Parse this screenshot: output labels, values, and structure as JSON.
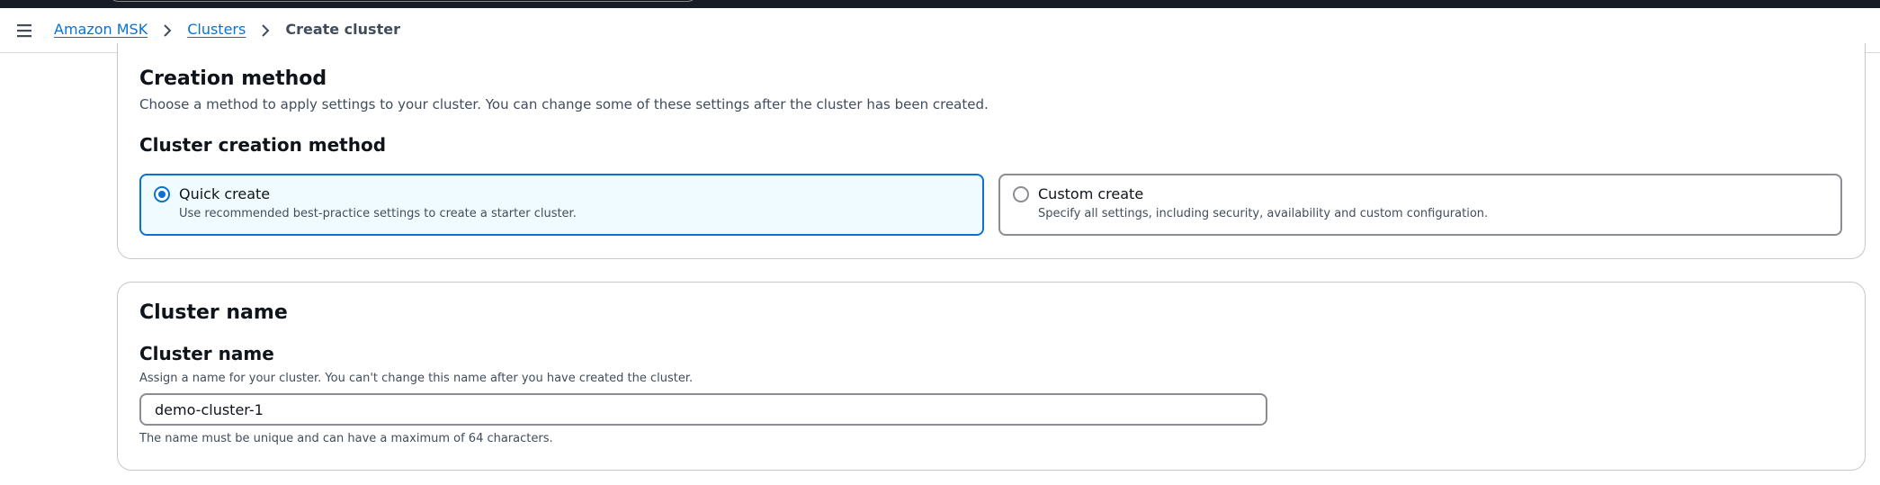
{
  "breadcrumb": {
    "items": [
      "Amazon MSK",
      "Clusters"
    ],
    "current": "Create cluster"
  },
  "creation_method": {
    "title": "Creation method",
    "description": "Choose a method to apply settings to your cluster. You can change some of these settings after the cluster has been created.",
    "field_label": "Cluster creation method",
    "options": [
      {
        "label": "Quick create",
        "description": "Use recommended best-practice settings to create a starter cluster.",
        "selected": true
      },
      {
        "label": "Custom create",
        "description": "Specify all settings, including security, availability and custom configuration.",
        "selected": false
      }
    ]
  },
  "cluster_name": {
    "title": "Cluster name",
    "field_label": "Cluster name",
    "field_description": "Assign a name for your cluster. You can't change this name after you have created the cluster.",
    "value": "demo-cluster-1",
    "constraint": "The name must be unique and can have a maximum of 64 characters."
  },
  "colors": {
    "accent": "#0972d3",
    "topbar": "#161d26",
    "selected_tile_bg": "#f0fbff"
  },
  "icons": {
    "menu": "hamburger-menu-icon",
    "separator": "chevron-right-icon"
  }
}
